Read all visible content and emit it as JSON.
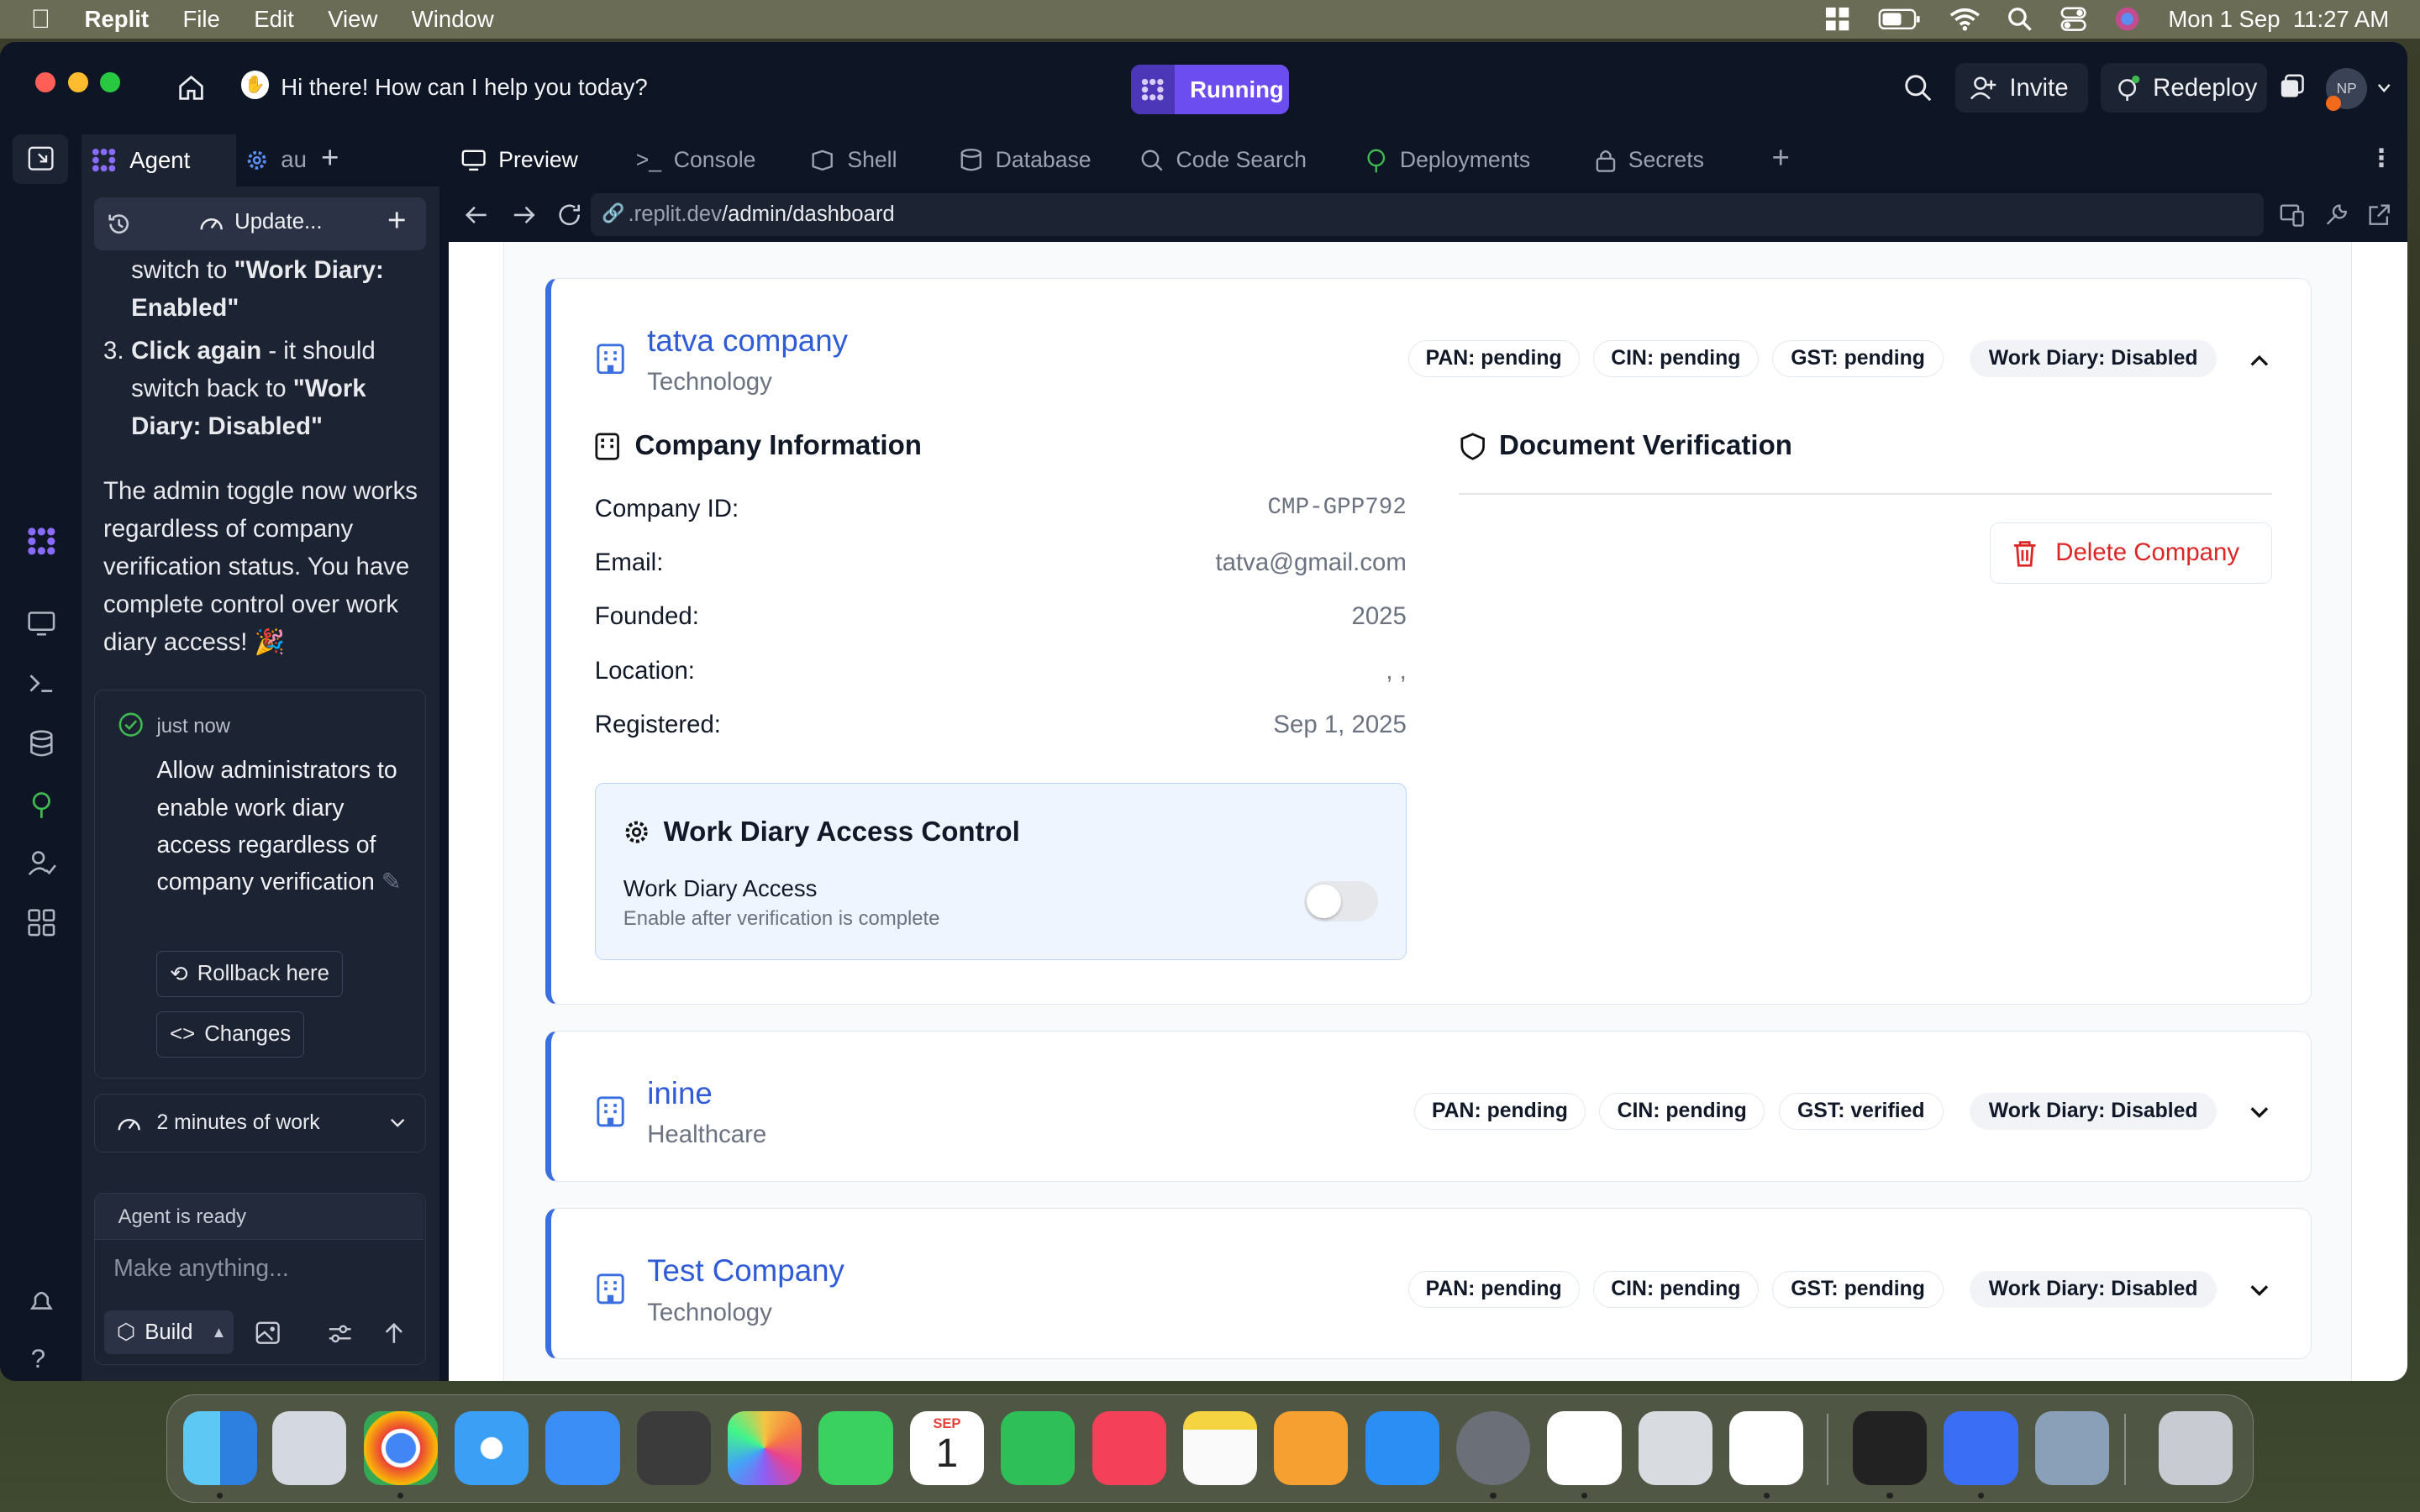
{
  "menubar": {
    "app": "Replit",
    "items": [
      "File",
      "Edit",
      "View",
      "Window"
    ],
    "datetime": "Mon 1 Sep  11:27 AM"
  },
  "topbar": {
    "greeting": "Hi there! How can I help you today?",
    "status": "Running",
    "invite": "Invite",
    "redeploy": "Redeploy",
    "avatar": "NP"
  },
  "agent": {
    "tab_agent": "Agent",
    "tab_other": "au",
    "update_label": "Update...",
    "step_a": "switch to ",
    "step_a_bold": "\"Work Diary: Enabled\"",
    "step3_num": "3.",
    "step3_bold": "Click again",
    "step3_text": " - it should switch back to ",
    "step3_bold2": "\"Work Diary: Disabled\"",
    "paragraph": "The admin toggle now works regardless of company verification status. You have complete control over work diary access! 🎉",
    "checkpoint_time": "just now",
    "checkpoint_text": "Allow administrators to enable work diary access regardless of company verification",
    "rollback": "Rollback here",
    "changes": "Changes",
    "work_time": "2 minutes of work",
    "ready": "Agent is ready",
    "input_placeholder": "Make anything...",
    "build": "Build"
  },
  "tabs": [
    "Preview",
    "Console",
    "Shell",
    "Database",
    "Code Search",
    "Deployments",
    "Secrets"
  ],
  "url": {
    "prefix": ".replit.dev",
    "path": "/admin/dashboard"
  },
  "companies": [
    {
      "name": "tatva company",
      "industry": "Technology",
      "badges": [
        "PAN: pending",
        "CIN: pending",
        "GST: pending",
        "Work Diary: Disabled"
      ],
      "expanded": true
    },
    {
      "name": "inine",
      "industry": "Healthcare",
      "badges": [
        "PAN: pending",
        "CIN: pending",
        "GST: verified",
        "Work Diary: Disabled"
      ],
      "expanded": false
    },
    {
      "name": "Test Company",
      "industry": "Technology",
      "badges": [
        "PAN: pending",
        "CIN: pending",
        "GST: pending",
        "Work Diary: Disabled"
      ],
      "expanded": false
    }
  ],
  "details": {
    "info_title": "Company Information",
    "doc_title": "Document Verification",
    "rows": [
      {
        "label": "Company ID:",
        "value": "CMP-GPP792"
      },
      {
        "label": "Email:",
        "value": "tatva@gmail.com"
      },
      {
        "label": "Founded:",
        "value": "2025"
      },
      {
        "label": "Location:",
        "value": ", ,"
      },
      {
        "label": "Registered:",
        "value": "Sep 1, 2025"
      }
    ],
    "delete": "Delete Company",
    "wd_title": "Work Diary Access Control",
    "wd_label": "Work Diary Access",
    "wd_sub": "Enable after verification is complete",
    "wd_enabled": false
  },
  "dock_apps": [
    "finder",
    "launchpad",
    "chrome",
    "safari",
    "mail",
    "calculator",
    "photos",
    "facetime",
    "calendar",
    "numbers",
    "music",
    "notes",
    "pages",
    "app-store",
    "system-settings",
    "windows",
    "iphone-mirroring",
    "vscode",
    "replit",
    "dropzone",
    "preview",
    "trash"
  ],
  "calendar": {
    "month": "SEP",
    "day": "1"
  }
}
